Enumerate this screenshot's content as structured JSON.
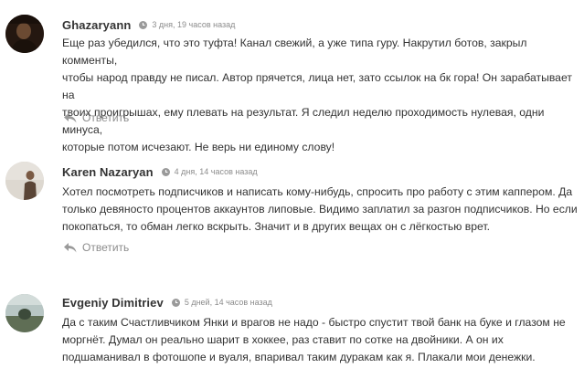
{
  "comments": [
    {
      "author": "Ghazaryann",
      "date": "3 дня, 19 часов назад",
      "text_lines": [
        "Еще раз убедился, что это туфта! Канал свежий, а уже типа гуру. Накрутил ботов, закрыл комменты,",
        "чтобы народ правду не писал. Автор прячется, лица нет, зато ссылок на бк гора! Он зарабатывает на",
        "твоих проигрышах, ему плевать на результат. Я следил неделю проходимость нулевая, одни минуса,",
        "которые потом исчезают. Не верь ни единому слову!"
      ],
      "reply_label": "Ответить"
    },
    {
      "author": "Karen Nazaryan",
      "date": "4 дня, 14 часов назад",
      "text_lines": [
        "Хотел посмотреть подписчиков и написать кому-нибудь, спросить про работу с этим каппером. Да",
        "только девяносто процентов аккаунтов липовые. Видимо заплатил за разгон подписчиков. Но если",
        "покопаться, то обман легко вскрыть. Значит и в других вещах он с лёгкостью врет."
      ],
      "reply_label": "Ответить"
    },
    {
      "author": "Evgeniy Dimitriev",
      "date": "5 дней, 14 часов назад",
      "text_lines": [
        "Да с таким Счастливчиком Янки и врагов не надо - быстро спустит твой банк на буке и глазом не",
        "моргнёт. Думал он реально шарит в хоккее, раз ставит по сотке на двойники. А он их",
        "подшаманивал в фотошопе и вуаля, впаривал таким дуракам как я. Плакали мои денежки."
      ]
    }
  ],
  "icons": {
    "clock": "clock-icon",
    "reply": "reply-arrow-icon"
  },
  "colors": {
    "text": "#333333",
    "muted": "#8c8c8c"
  }
}
